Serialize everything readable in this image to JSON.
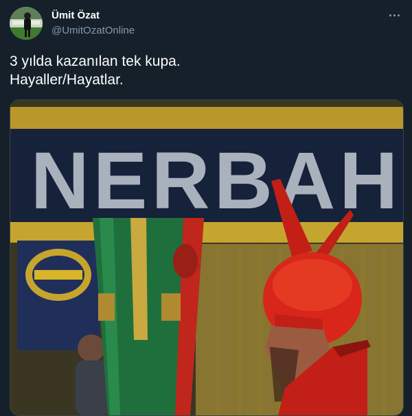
{
  "tweet": {
    "display_name": "Ümit Özat",
    "handle": "@UmitOzatOnline",
    "text_lines": [
      "3 yılda kazanılan tek kupa.",
      "Hayaller/Hayatlar."
    ],
    "more_icon": "more-horizontal-icon"
  },
  "media": {
    "banner_text": "NERBAH"
  },
  "colors": {
    "background": "#15202b",
    "secondary_text": "#8899a6",
    "banner_yellow": "#d9b52a",
    "banner_navy": "#16213a",
    "fan_red": "#d8261a"
  }
}
